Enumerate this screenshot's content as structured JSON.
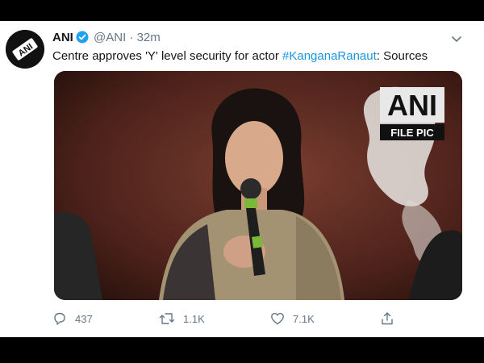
{
  "tweet": {
    "author_name": "ANI",
    "handle": "@ANI",
    "separator": "·",
    "time": "32m",
    "text_before": "Centre approves 'Y' level security for actor ",
    "hashtag": "#KanganaRanaut",
    "text_after": ": Sources",
    "avatar_label": "ANI"
  },
  "media": {
    "watermark_top": "ANI",
    "watermark_bottom": "FILE PIC"
  },
  "actions": {
    "reply_count": "437",
    "retweet_count": "1.1K",
    "like_count": "7.1K"
  },
  "colors": {
    "link": "#1b95e0",
    "muted": "#657786",
    "verified": "#1da1f2"
  }
}
